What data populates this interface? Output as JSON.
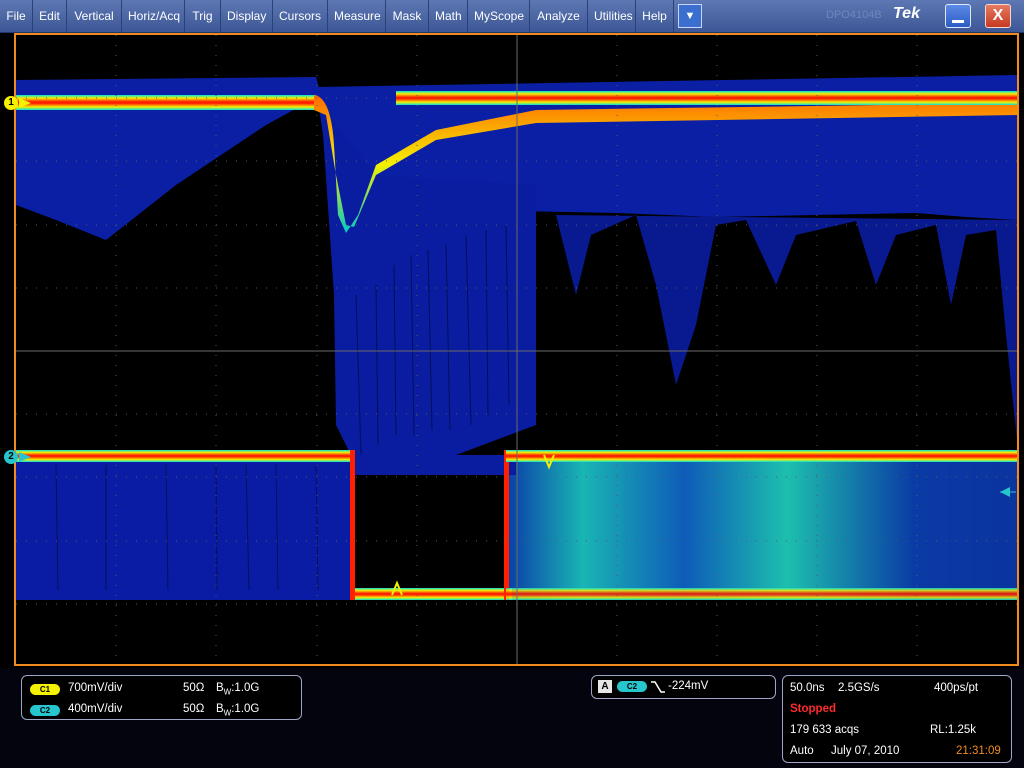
{
  "menubar": {
    "items": [
      "File",
      "Edit",
      "Vertical",
      "Horiz/Acq",
      "Trig",
      "Display",
      "Cursors",
      "Measure",
      "Mask",
      "Math",
      "MyScope",
      "Analyze",
      "Utilities",
      "Help"
    ],
    "dropdown_icon": "chevron-down-icon",
    "logo_ghost": "DPO4104B",
    "logo": "Tek",
    "minimize_icon": "minimize-icon",
    "close_label": "X"
  },
  "colors": {
    "menubar": "#4563a2",
    "frame": "#f08c1f",
    "ch1": "#f4f200",
    "ch2": "#27c5ce",
    "stopped": "#ff2a2a",
    "clock": "#f08c1f"
  },
  "markers": {
    "ch1": "1",
    "ch2": "2"
  },
  "channels": [
    {
      "badge": "C1",
      "scale": "700mV/div",
      "impedance": "50Ω",
      "bw_prefix": "B",
      "bw_sub": "W",
      "bw_value": ":1.0G"
    },
    {
      "badge": "C2",
      "scale": "400mV/div",
      "impedance": "50Ω",
      "bw_prefix": "B",
      "bw_sub": "W",
      "bw_value": ":1.0G"
    }
  ],
  "trigger": {
    "mode_badge": "A",
    "source_badge": "C2",
    "slope_icon": "falling-edge-icon",
    "level": "-224mV"
  },
  "acquisition": {
    "time_per_div": "50.0ns",
    "sample_rate": "2.5GS/s",
    "resolution": "400ps/pt",
    "status": "Stopped",
    "acq_count": "179 633 acqs",
    "record_length": "RL:1.25k",
    "trigger_mode": "Auto",
    "date": "July 07, 2010",
    "time": "21:31:09"
  }
}
